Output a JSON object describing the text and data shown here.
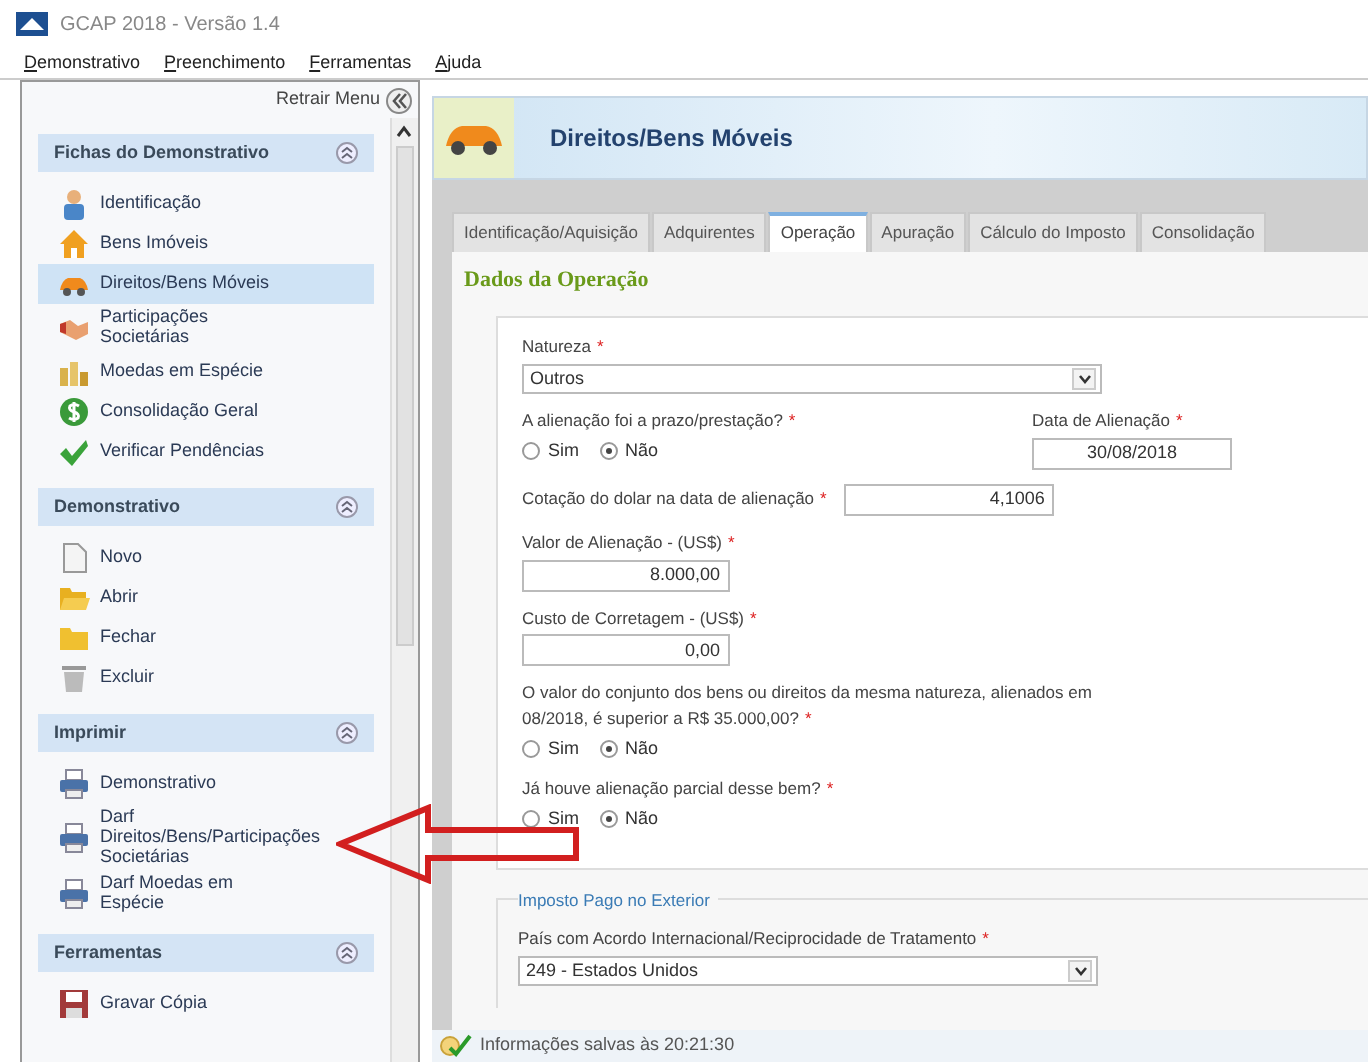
{
  "window": {
    "title": "GCAP 2018 - Versão 1.4"
  },
  "menu": [
    "Demonstrativo",
    "Preenchimento",
    "Ferramentas",
    "Ajuda"
  ],
  "sidebar": {
    "collapse_label": "Retrair Menu",
    "sections": [
      {
        "title": "Fichas do Demonstrativo",
        "items": [
          {
            "label": "Identificação",
            "selected": false
          },
          {
            "label": "Bens Imóveis",
            "selected": false
          },
          {
            "label": "Direitos/Bens Móveis",
            "selected": true
          },
          {
            "label": "Participações Societárias",
            "selected": false
          },
          {
            "label": "Moedas em Espécie",
            "selected": false
          },
          {
            "label": "Consolidação Geral",
            "selected": false
          },
          {
            "label": "Verificar Pendências",
            "selected": false
          }
        ]
      },
      {
        "title": "Demonstrativo",
        "items": [
          {
            "label": "Novo",
            "selected": false
          },
          {
            "label": "Abrir",
            "selected": false
          },
          {
            "label": "Fechar",
            "selected": false
          },
          {
            "label": "Excluir",
            "selected": false
          }
        ]
      },
      {
        "title": "Imprimir",
        "items": [
          {
            "label": "Demonstrativo",
            "selected": false
          },
          {
            "label": "Darf Direitos/Bens/Participações Societárias",
            "selected": false
          },
          {
            "label": "Darf Moedas em Espécie",
            "selected": false
          }
        ]
      },
      {
        "title": "Ferramentas",
        "items": [
          {
            "label": "Gravar Cópia",
            "selected": false
          }
        ]
      }
    ]
  },
  "page": {
    "title": "Direitos/Bens Móveis",
    "tabs": [
      {
        "label": "Identificação/Aquisição",
        "selected": false
      },
      {
        "label": "Adquirentes",
        "selected": false
      },
      {
        "label": "Operação",
        "selected": true
      },
      {
        "label": "Apuração",
        "selected": false
      },
      {
        "label": "Cálculo do Imposto",
        "selected": false
      },
      {
        "label": "Consolidação",
        "selected": false
      }
    ],
    "section_title": "Dados da Operação",
    "fields": [
      {
        "kind": "select",
        "label": "Natureza",
        "mark": "*",
        "value": "Outros"
      },
      {
        "kind": "radio",
        "label": "A alienação foi a prazo/prestação?",
        "mark": "*",
        "options": [
          {
            "label": "Sim",
            "selected": false
          },
          {
            "label": "Não",
            "selected": true
          }
        ],
        "side": {
          "label": "Data de Alienação",
          "mark": "*",
          "value": "30/08/2018"
        }
      },
      {
        "kind": "inline",
        "label": "Cotação do dolar na data de alienação",
        "mark": "*",
        "value": "4,1006"
      },
      {
        "kind": "text",
        "label": "Valor de Alienação - (US$)",
        "mark": "*",
        "value": "8.000,00"
      },
      {
        "kind": "text",
        "label": "Custo de Corretagem - (US$)",
        "mark": "*",
        "value": "0,00"
      },
      {
        "kind": "radio",
        "label": "O valor do conjunto dos bens ou direitos da mesma natureza, alienados em 08/2018, é superior a R$ 35.000,00?",
        "mark": "*",
        "options": [
          {
            "label": "Sim",
            "selected": false
          },
          {
            "label": "Não",
            "selected": true
          }
        ]
      },
      {
        "kind": "radio",
        "label": "Já houve alienação parcial desse bem?",
        "mark": "*",
        "options": [
          {
            "label": "Sim",
            "selected": false
          },
          {
            "label": "Não",
            "selected": true
          }
        ]
      }
    ],
    "fieldset": {
      "legend": "Imposto Pago no Exterior",
      "fields": [
        {
          "kind": "select",
          "label": "País com Acordo Internacional/Reciprocidade de Tratamento",
          "mark": "*",
          "value": "249 - Estados Unidos"
        }
      ]
    }
  },
  "status_bar": {
    "message": "Informações salvas às 20:21:30"
  }
}
